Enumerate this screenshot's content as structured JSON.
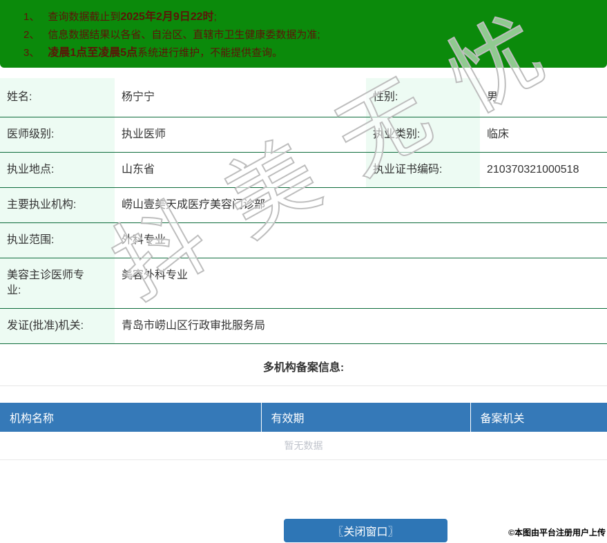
{
  "colors": {
    "banner_bg": "#0b8a0b",
    "banner_text": "#5c1408",
    "row_border_green": "#0c6b3a",
    "label_cell_bg": "#edfbf3",
    "org_header_bg": "#3579b8",
    "button_bg": "#2e76b6",
    "empty_text_color": "#c0c4cc"
  },
  "banner": {
    "notices": [
      {
        "num": "1、",
        "pre": "查询数据截止到",
        "bold": "2025年2月9日22时",
        "post": ";"
      },
      {
        "num": "2、",
        "pre": "信息数据结果以各省、自治区、直辖市卫生健康委数据为准;",
        "bold": "",
        "post": ""
      },
      {
        "num": "3、",
        "pre": "",
        "bold": "凌晨1点至凌晨5点",
        "post": "系统进行维护，不能提供查询。"
      }
    ]
  },
  "info": {
    "rows2": [
      {
        "l1": "姓名:",
        "v1": "杨宁宁",
        "l2": "性别:",
        "v2": "男"
      },
      {
        "l1": "医师级别:",
        "v1": "执业医师",
        "l2": "执业类别:",
        "v2": "临床"
      },
      {
        "l1": "执业地点:",
        "v1": "山东省",
        "l2": "执业证书编码:",
        "v2": "210370321000518"
      }
    ],
    "rows1": [
      {
        "l": "主要执业机构:",
        "v": "崂山壹美天成医疗美容门诊部"
      },
      {
        "l": "执业范围:",
        "v": "外科专业"
      },
      {
        "l": "美容主诊医师专业:",
        "v": "美容外科专业"
      },
      {
        "l": "发证(批准)机关:",
        "v": "青岛市崂山区行政审批服务局"
      }
    ]
  },
  "multi_org": {
    "title": "多机构备案信息:",
    "columns": [
      "机构名称",
      "有效期",
      "备案机关"
    ],
    "empty_text": "暂无数据"
  },
  "footer": {
    "close_button": "〖关闭窗口〗",
    "copyright": "©本图由平台注册用户上传"
  },
  "watermark": {
    "text": "抖美无忧"
  }
}
